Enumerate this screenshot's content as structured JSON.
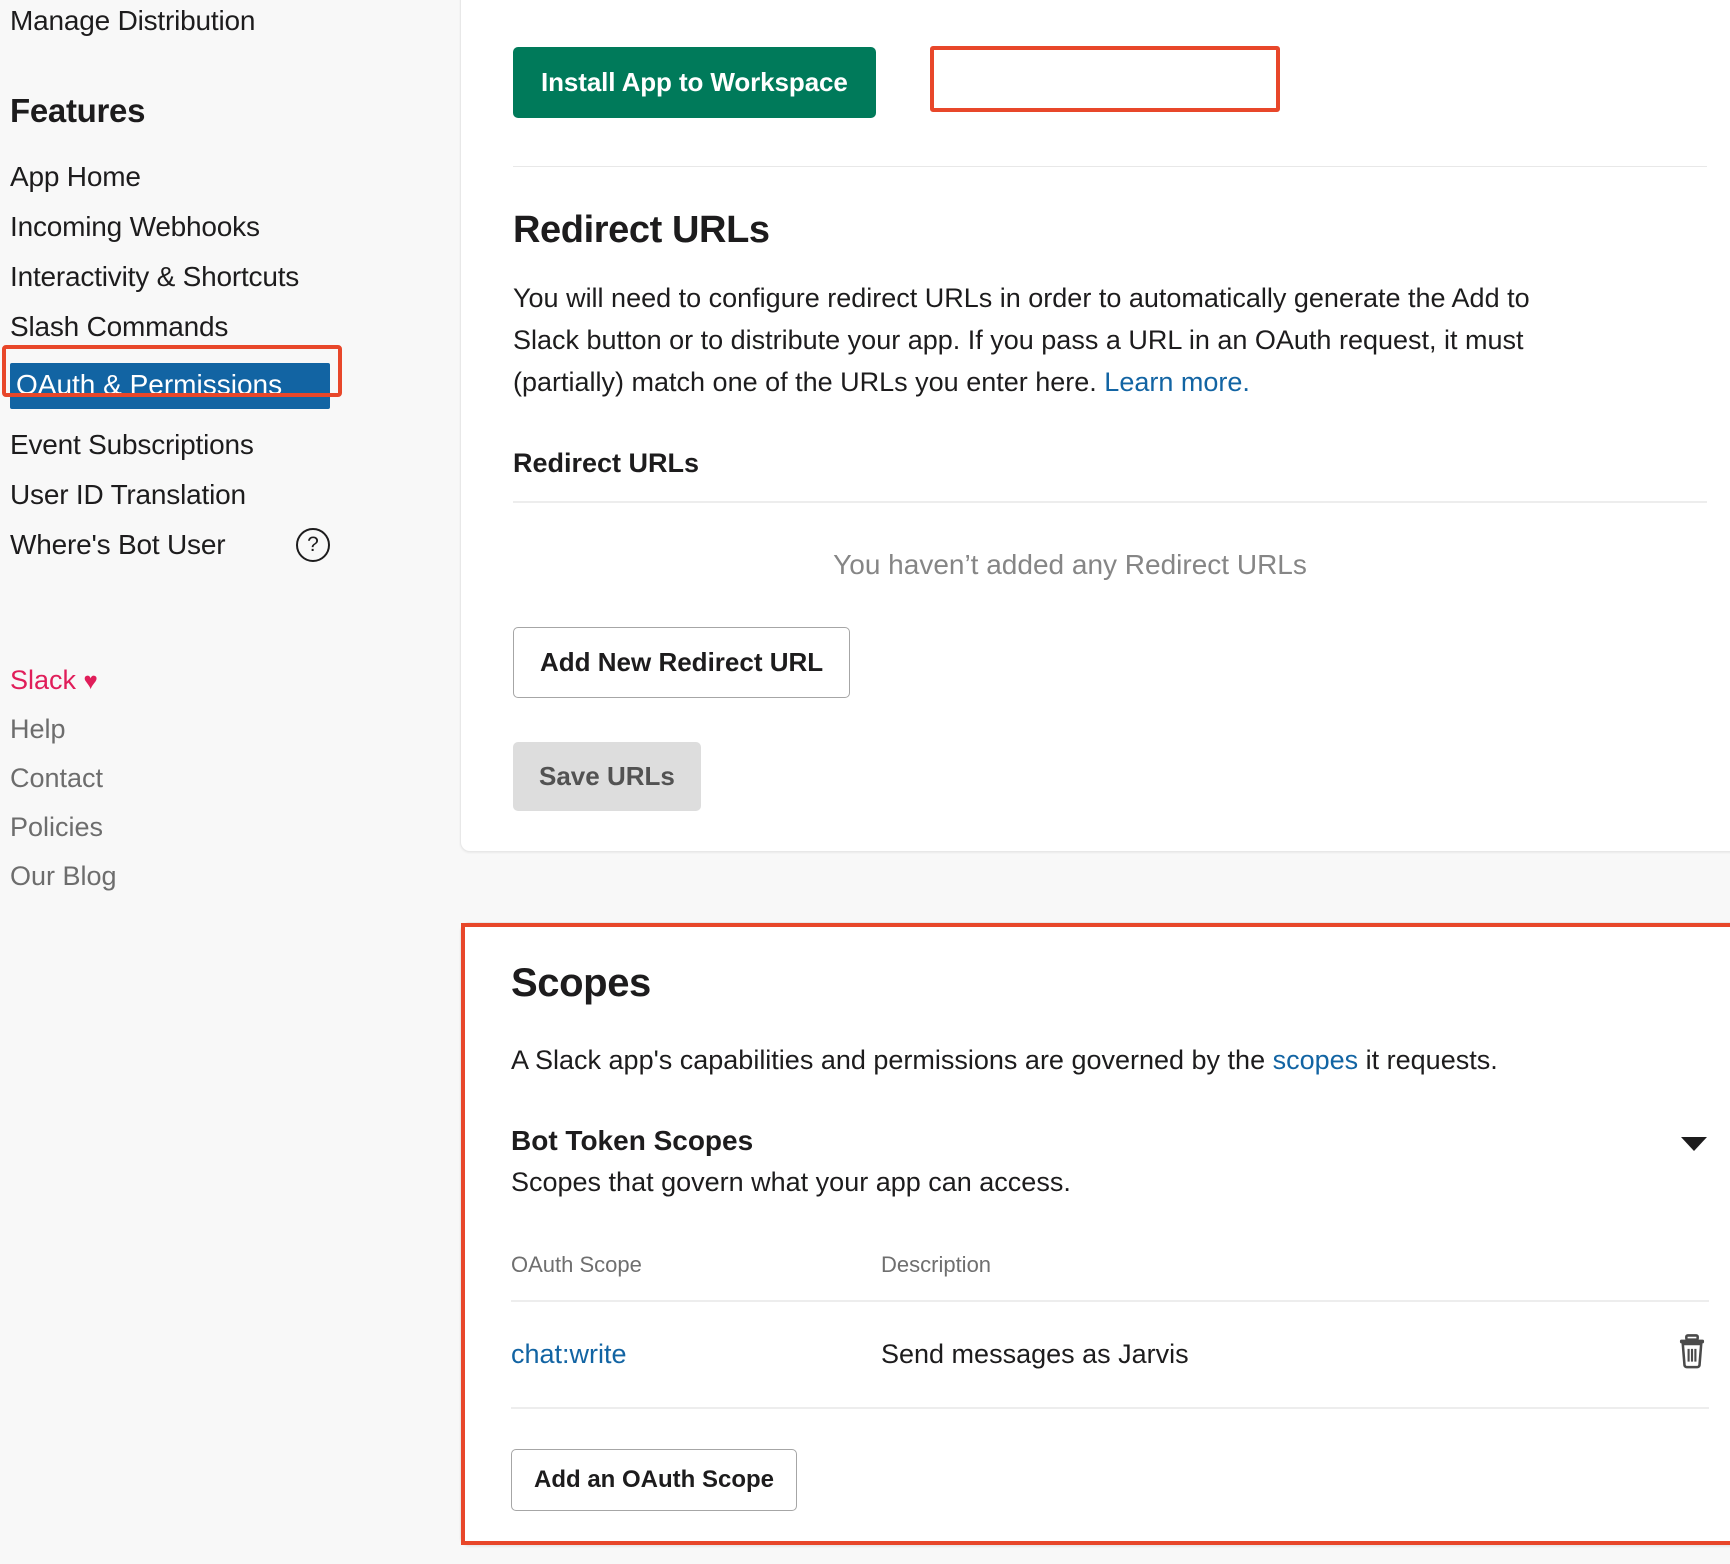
{
  "sidebar": {
    "top_link": "Manage Distribution",
    "features_heading": "Features",
    "items": [
      {
        "label": "App Home"
      },
      {
        "label": "Incoming Webhooks"
      },
      {
        "label": "Interactivity & Shortcuts"
      },
      {
        "label": "Slash Commands"
      },
      {
        "label": "OAuth & Permissions"
      },
      {
        "label": "Event Subscriptions"
      },
      {
        "label": "User ID Translation"
      },
      {
        "label": "Where's Bot User"
      }
    ],
    "help_icon_label": "?",
    "footer": {
      "brand": "Slack",
      "heart": "♥",
      "links": [
        "Help",
        "Contact",
        "Policies",
        "Our Blog"
      ]
    }
  },
  "install": {
    "button_label": "Install App to Workspace"
  },
  "redirect": {
    "heading": "Redirect URLs",
    "description_1": "You will need to configure redirect URLs in order to automatically generate the Add to Slack button or to distribute your app. If you pass a URL in an OAuth request, it must (partially) match one of the URLs you enter here. ",
    "learn_more": "Learn more.",
    "sub_heading": "Redirect URLs",
    "empty_message": "You haven’t added any Redirect URLs",
    "add_button": "Add New Redirect URL",
    "save_button": "Save URLs"
  },
  "scopes": {
    "heading": "Scopes",
    "description_before": "A Slack app's capabilities and permissions are governed by the ",
    "description_link": "scopes",
    "description_after": " it requests.",
    "bot_token_title": "Bot Token Scopes",
    "bot_token_sub": "Scopes that govern what your app can access.",
    "columns": [
      "OAuth Scope",
      "Description"
    ],
    "rows": [
      {
        "scope": "chat:write",
        "description": "Send messages as Jarvis",
        "delete_icon": "trash-icon"
      }
    ],
    "add_scope_button": "Add an OAuth Scope"
  },
  "colors": {
    "accent_green": "#007a5a",
    "link_blue": "#1264a3",
    "annotation_red": "#e8472a",
    "selected_blue": "#1264a3",
    "slack_pink": "#e01e5a"
  }
}
